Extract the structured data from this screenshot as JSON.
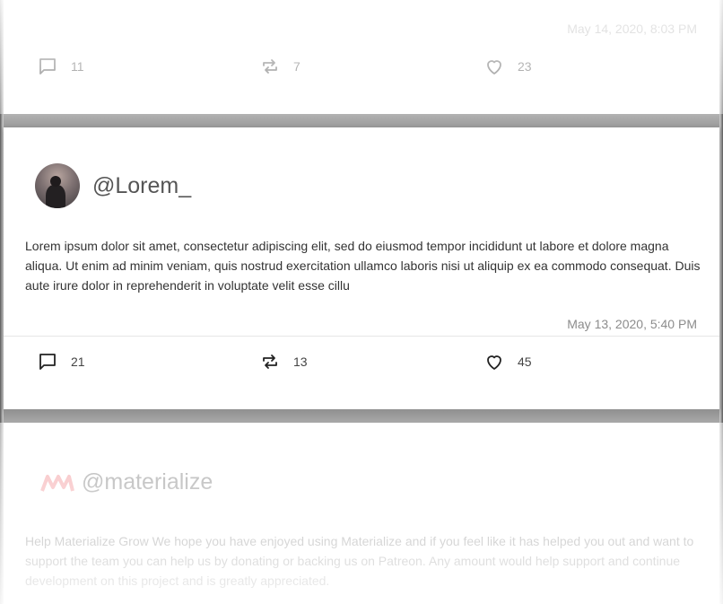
{
  "posts": [
    {
      "timestamp": "May 14, 2020, 8:03 PM",
      "comments": "11",
      "retweets": "7",
      "likes": "23"
    },
    {
      "handle": "@Lorem_",
      "text": "Lorem ipsum dolor sit amet, consectetur adipiscing elit, sed do eiusmod tempor incididunt ut labore et dolore magna aliqua. Ut enim ad minim veniam, quis nostrud exercitation ullamco laboris nisi ut aliquip ex ea commodo consequat. Duis aute irure dolor in reprehenderit in voluptate velit esse cillu",
      "timestamp": "May 13, 2020, 5:40 PM",
      "comments": "21",
      "retweets": "13",
      "likes": "45"
    },
    {
      "handle": "@materialize",
      "text": "Help Materialize Grow We hope you have enjoyed using Materialize and if you feel like it has helped you out and want to support the team you can help us by donating or backing us on Patreon. Any amount would help support and continue development on this project and is greatly appreciated."
    }
  ],
  "icons": {
    "comment": "comment-icon",
    "retweet": "retweet-icon",
    "like": "heart-icon",
    "brand": "materialize-logo-icon"
  },
  "colors": {
    "brand": "#ee6e73",
    "muted_text": "#8c8c8c"
  }
}
